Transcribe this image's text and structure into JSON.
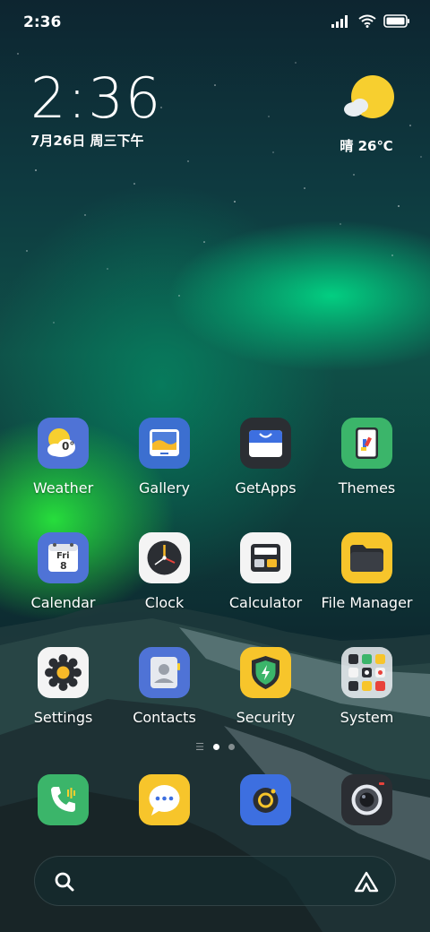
{
  "status_bar": {
    "time": "2:36",
    "icons": [
      "signal-icon",
      "wifi-icon",
      "battery-icon"
    ]
  },
  "clock_widget": {
    "time": "2:36",
    "date": "7月26日 周三下午"
  },
  "weather_widget": {
    "icon": "sun-cloud-icon",
    "text": "晴 26℃"
  },
  "apps": [
    {
      "label": "Weather",
      "icon": "weather-icon"
    },
    {
      "label": "Gallery",
      "icon": "gallery-icon"
    },
    {
      "label": "GetApps",
      "icon": "getapps-icon"
    },
    {
      "label": "Themes",
      "icon": "themes-icon"
    },
    {
      "label": "Calendar",
      "icon": "calendar-icon"
    },
    {
      "label": "Clock",
      "icon": "clock-icon"
    },
    {
      "label": "Calculator",
      "icon": "calculator-icon"
    },
    {
      "label": "File Manager",
      "icon": "file-manager-icon"
    },
    {
      "label": "Settings",
      "icon": "settings-icon"
    },
    {
      "label": "Contacts",
      "icon": "contacts-icon"
    },
    {
      "label": "Security",
      "icon": "security-icon"
    },
    {
      "label": "System",
      "icon": "system-folder-icon"
    }
  ],
  "weather_app_badge": "0°",
  "calendar_app_badge": {
    "day": "Fri",
    "date": "8"
  },
  "dock": [
    {
      "icon": "phone-icon"
    },
    {
      "icon": "messaging-icon"
    },
    {
      "icon": "browser-icon"
    },
    {
      "icon": "camera-icon"
    }
  ],
  "page_indicator": {
    "pages": 2,
    "current": 1
  },
  "search_bar": {
    "left_icon": "search-icon",
    "right_icon": "assistant-icon"
  }
}
